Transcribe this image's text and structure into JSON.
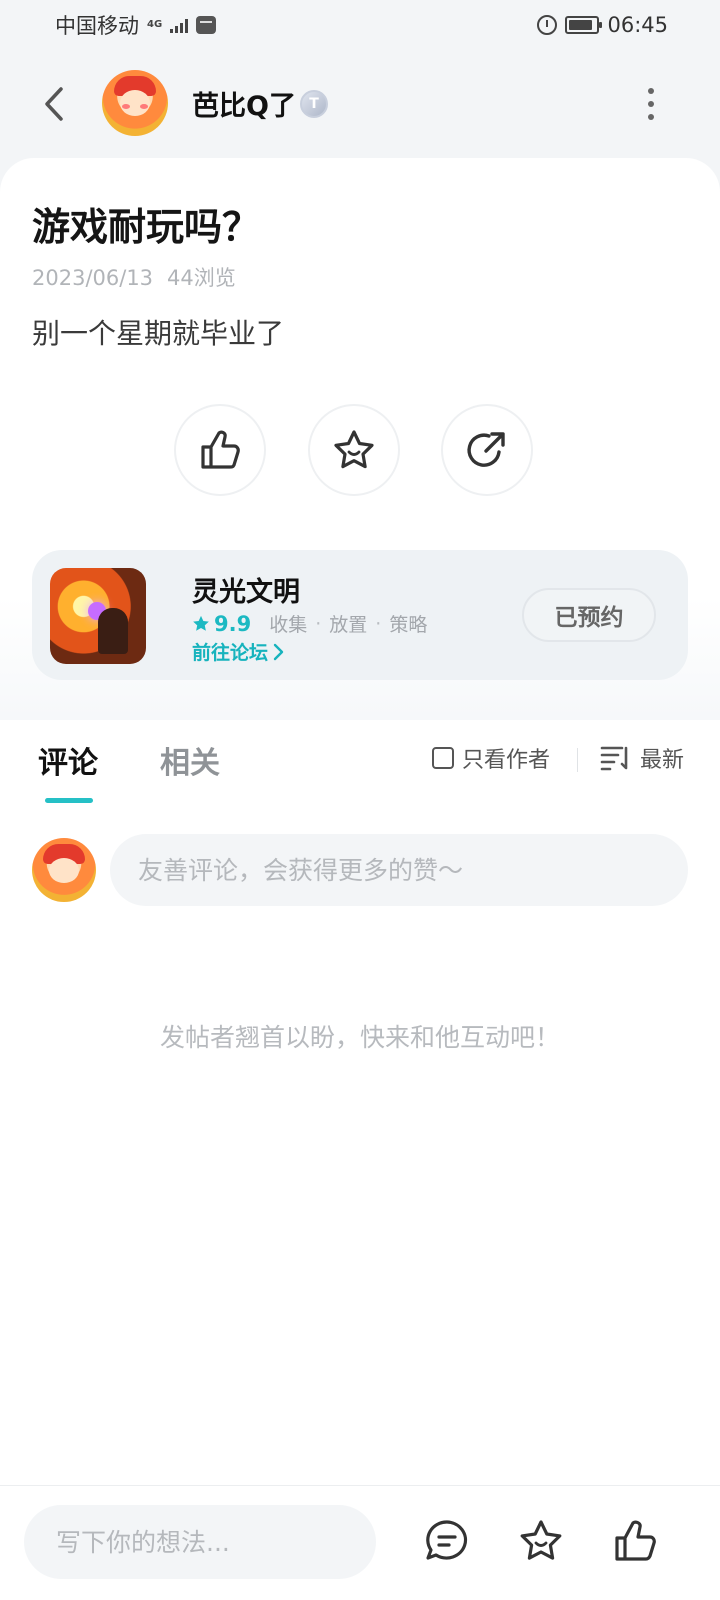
{
  "status_bar": {
    "carrier": "中国移动",
    "network": "4G",
    "time": "06:45",
    "battery_level": 0.85
  },
  "header": {
    "username": "芭比Q了",
    "level_badge": "T",
    "icons": [
      "back-arrow-icon",
      "more-vertical-icon"
    ]
  },
  "post": {
    "title": "游戏耐玩吗？",
    "date": "2023/06/13",
    "views": "44浏览",
    "body": "别一个星期就毕业了",
    "actions": [
      "like-icon",
      "star-icon",
      "share-icon"
    ]
  },
  "game": {
    "name": "灵光文明",
    "rating": "9.9",
    "tags": [
      "收集",
      "放置",
      "策略"
    ],
    "forum_link": "前往论坛",
    "reserve_label": "已预约"
  },
  "comments": {
    "tabs": [
      "评论",
      "相关"
    ],
    "only_author_label": "只看作者",
    "sort_label": "最新",
    "input_placeholder": "友善评论，会获得更多的赞～",
    "empty_hint": "发帖者翘首以盼，快来和他互动吧！"
  },
  "bottom_bar": {
    "input_placeholder": "写下你的想法...",
    "icons": [
      "comment-icon",
      "star-icon",
      "like-icon"
    ]
  },
  "colors": {
    "accent": "#25c0c6",
    "background": "#f3f5f7"
  }
}
